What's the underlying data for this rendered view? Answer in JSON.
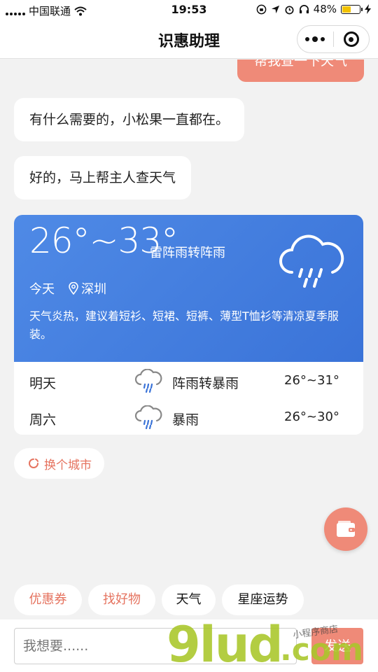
{
  "status_bar": {
    "carrier": "中国联通",
    "time": "19:53",
    "battery_percent": "48%",
    "battery_level": 0.48,
    "battery_color": "#f2c200"
  },
  "nav": {
    "title": "识惠助理",
    "more_icon": "more-dots-icon",
    "close_icon": "target-circle-icon"
  },
  "messages": {
    "user_query": "帮我查一下天气",
    "bot_greeting": "有什么需要的，小松果一直都在。",
    "bot_reply": "好的，马上帮主人查天气"
  },
  "weather": {
    "temp_range": "26°~33°",
    "condition": "雷阵雨转阵雨",
    "day": "今天",
    "city": "深圳",
    "tip": "天气炎热，建议着短衫、短裙、短裤、薄型T恤衫等清凉夏季服装。",
    "icon": "rain-cloud-icon",
    "card_color": "#3f7bdd",
    "forecast": [
      {
        "day": "明天",
        "icon": "rain-cloud-icon",
        "weather": "阵雨转暴雨",
        "temp": "26°~31°"
      },
      {
        "day": "周六",
        "icon": "rain-cloud-icon",
        "weather": "暴雨",
        "temp": "26°~30°"
      }
    ]
  },
  "actions": {
    "change_city": "换个城市",
    "change_city_icon": "refresh-icon",
    "fab_icon": "wallet-icon"
  },
  "chips": [
    "优惠券",
    "找好物",
    "天气",
    "星座运势"
  ],
  "input": {
    "placeholder": "我想要......",
    "send": "发送"
  },
  "watermark": {
    "brand": "9lud",
    "suffix": ".com",
    "note": "小程序商店"
  },
  "colors": {
    "accent": "#ef8a78",
    "accent_text": "#e5735f"
  }
}
